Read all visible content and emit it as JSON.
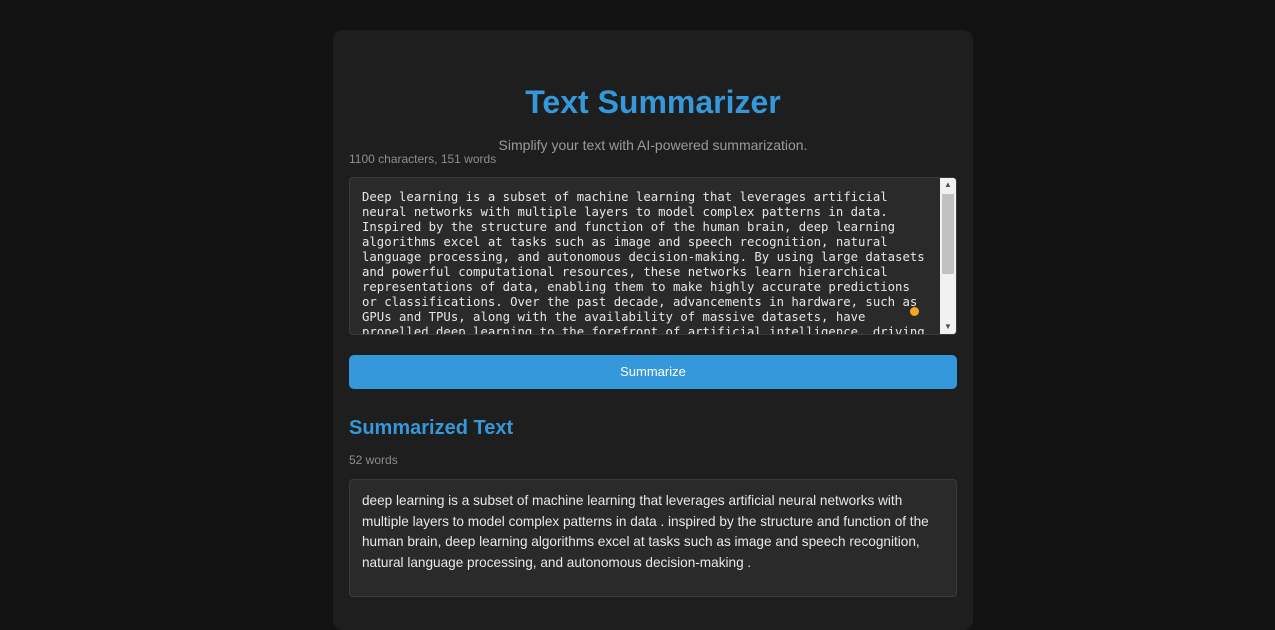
{
  "header": {
    "title": "Text Summarizer",
    "subtitle": "Simplify your text with AI-powered summarization."
  },
  "input": {
    "count": "1100 characters, 151 words",
    "value": "Deep learning is a subset of machine learning that leverages artificial neural networks with multiple layers to model complex patterns in data. Inspired by the structure and function of the human brain, deep learning algorithms excel at tasks such as image and speech recognition, natural language processing, and autonomous decision-making. By using large datasets and powerful computational resources, these networks learn hierarchical representations of data, enabling them to make highly accurate predictions or classifications. Over the past decade, advancements in hardware, such as GPUs and TPUs, along with the availability of massive datasets, have propelled deep learning to the forefront of artificial intelligence, driving innovations in fields like healthcare,"
  },
  "actions": {
    "summarize_label": "Summarize"
  },
  "summary": {
    "title": "Summarized Text",
    "count": "52 words",
    "text": "deep learning is a subset of machine learning that leverages artificial neural networks with multiple layers to model complex patterns in data . inspired by the structure and function of the human brain, deep learning algorithms excel at tasks such as image and speech recognition, natural language processing, and autonomous decision-making ."
  },
  "colors": {
    "accent": "#3498db",
    "background": "#121212",
    "card": "#1e1e1e",
    "cursor": "#f5a623"
  },
  "icons": {
    "scroll_up": "triangle-up-icon",
    "scroll_down": "triangle-down-icon"
  }
}
